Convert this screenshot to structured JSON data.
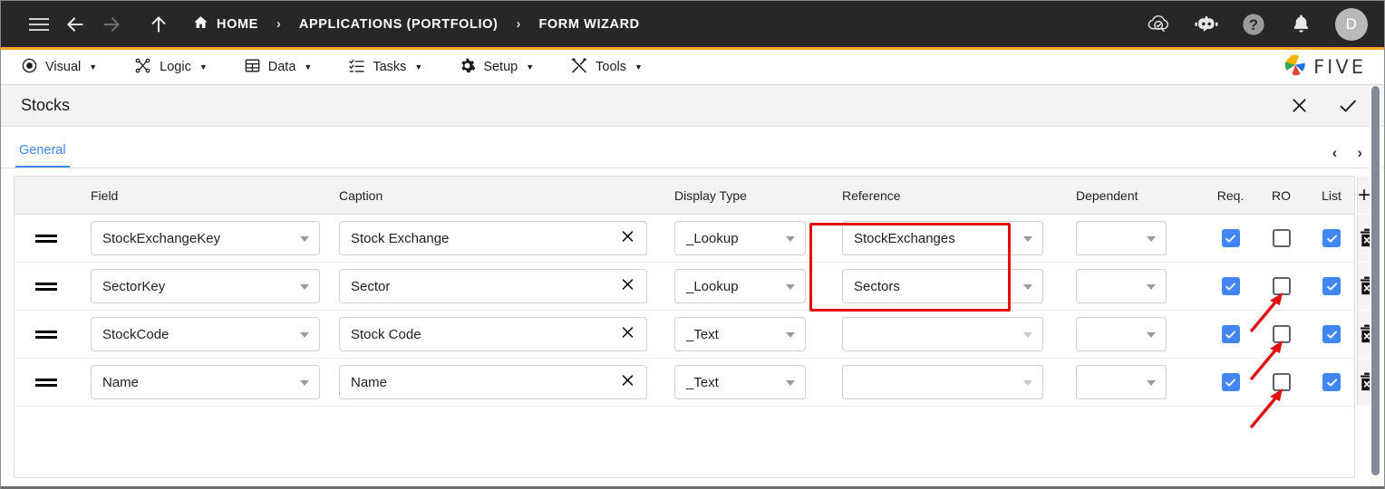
{
  "topbar": {
    "icons": {
      "menu": "hamburger-icon",
      "back": "back-arrow-icon",
      "forward": "forward-arrow-icon",
      "up": "up-arrow-icon"
    },
    "breadcrumbs": [
      {
        "label": "HOME",
        "icon": "home-icon"
      },
      {
        "label": "APPLICATIONS (PORTFOLIO)",
        "icon": ""
      },
      {
        "label": "FORM WIZARD",
        "icon": ""
      }
    ],
    "separator": "›",
    "right_icons": [
      {
        "name": "cloud-check-search-icon"
      },
      {
        "name": "chatbot-icon"
      },
      {
        "name": "help-icon"
      },
      {
        "name": "notifications-bell-icon"
      }
    ],
    "avatar_initial": "D",
    "accent_color": "#f5a623",
    "background_color": "#272727"
  },
  "menubar": {
    "items": [
      {
        "label": "Visual",
        "icon": "eye-icon",
        "caret": "▼"
      },
      {
        "label": "Logic",
        "icon": "logic-nodes-icon",
        "caret": "▼"
      },
      {
        "label": "Data",
        "icon": "table-icon",
        "caret": "▼"
      },
      {
        "label": "Tasks",
        "icon": "checklist-icon",
        "caret": "▼"
      },
      {
        "label": "Setup",
        "icon": "gear-icon",
        "caret": "▼"
      },
      {
        "label": "Tools",
        "icon": "tools-icon",
        "caret": "▼"
      }
    ],
    "brand": {
      "text": "FIVE",
      "icon": "five-pinwheel-logo"
    }
  },
  "panel": {
    "title": "Stocks",
    "close_icon": "close-icon",
    "confirm_icon": "check-icon",
    "tabs": [
      {
        "label": "General",
        "active": true
      }
    ],
    "tab_nav": {
      "prev": "‹",
      "next": "›"
    }
  },
  "grid": {
    "columns": [
      {
        "key": "handle",
        "label": ""
      },
      {
        "key": "field",
        "label": "Field"
      },
      {
        "key": "caption",
        "label": "Caption"
      },
      {
        "key": "dtype",
        "label": "Display Type"
      },
      {
        "key": "ref",
        "label": "Reference"
      },
      {
        "key": "dep",
        "label": "Dependent"
      },
      {
        "key": "req",
        "label": "Req."
      },
      {
        "key": "ro",
        "label": "RO"
      },
      {
        "key": "list",
        "label": "List"
      },
      {
        "key": "add",
        "label": "+"
      }
    ],
    "rows": [
      {
        "handle": "drag-handle-icon",
        "field": "StockExchangeKey",
        "caption": "Stock Exchange",
        "dtype": "_Lookup",
        "ref": "StockExchanges",
        "ref_empty": false,
        "dep": "",
        "req": true,
        "ro": false,
        "list": true,
        "delete_icon": "delete-row-icon"
      },
      {
        "handle": "drag-handle-icon",
        "field": "SectorKey",
        "caption": "Sector",
        "dtype": "_Lookup",
        "ref": "Sectors",
        "ref_empty": false,
        "dep": "",
        "req": true,
        "ro": false,
        "list": true,
        "delete_icon": "delete-row-icon"
      },
      {
        "handle": "drag-handle-icon",
        "field": "StockCode",
        "caption": "Stock Code",
        "dtype": "_Text",
        "ref": "",
        "ref_empty": true,
        "dep": "",
        "req": true,
        "ro": false,
        "list": true,
        "delete_icon": "delete-row-icon"
      },
      {
        "handle": "drag-handle-icon",
        "field": "Name",
        "caption": "Name",
        "dtype": "_Text",
        "ref": "",
        "ref_empty": true,
        "dep": "",
        "req": true,
        "ro": false,
        "list": true,
        "delete_icon": "delete-row-icon"
      }
    ],
    "clear_icon": "clear-icon"
  },
  "annotations": {
    "highlight_color": "#e01010",
    "highlight_box": {
      "label": "reference-column-highlight"
    },
    "arrows": [
      {
        "label": "arrow-to-list-checkbox-row-2"
      },
      {
        "label": "arrow-to-list-checkbox-row-3"
      },
      {
        "label": "arrow-to-list-checkbox-row-4"
      }
    ]
  },
  "scrollbar": {
    "name": "vertical-scrollbar"
  }
}
